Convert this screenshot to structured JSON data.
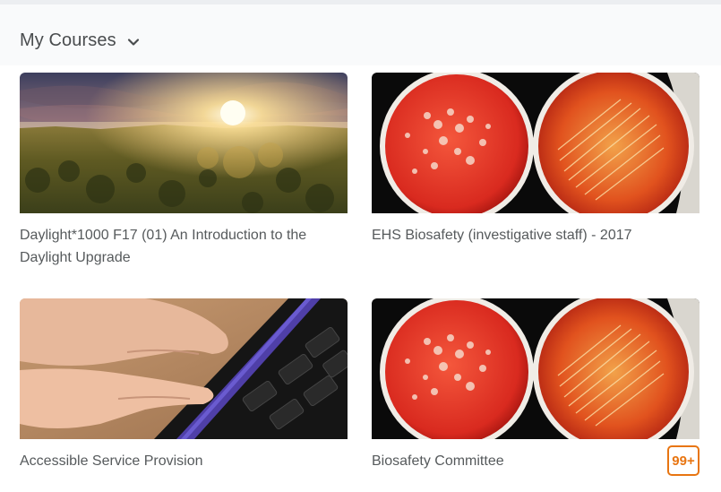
{
  "header": {
    "title": "My Courses",
    "dropdown_icon": "chevron-down-icon"
  },
  "courses": [
    {
      "name": "Daylight*1000 F17 (01) An Introduction to the Daylight Upgrade",
      "image": "forest-sunrise"
    },
    {
      "name": "EHS Biosafety (investigative staff) - 2017",
      "image": "petri-dishes"
    },
    {
      "name": "Accessible Service Provision",
      "image": "braille-keyboard"
    },
    {
      "name": "Biosafety Committee",
      "image": "petri-dishes",
      "badge": "99+"
    }
  ],
  "colors": {
    "accent": "#e87511",
    "text": "#565a5c",
    "header_bg": "#f9fafb"
  }
}
